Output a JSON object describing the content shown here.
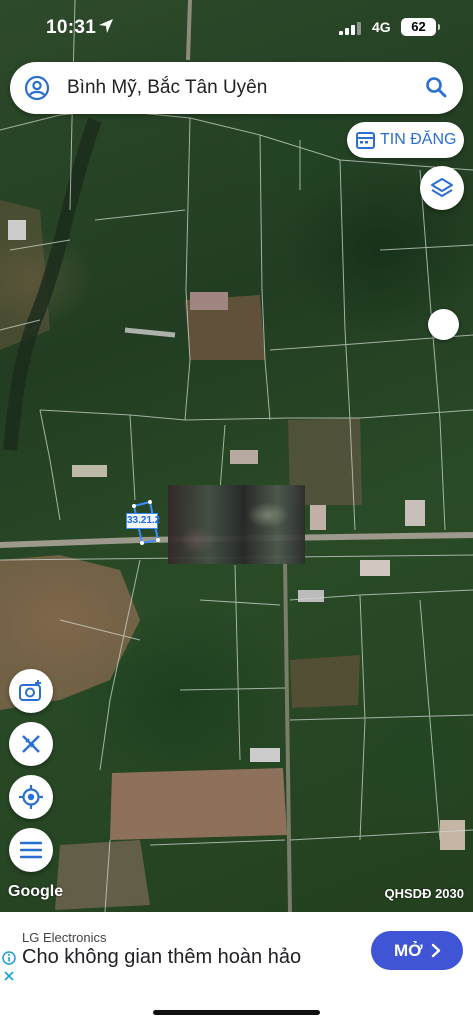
{
  "status_bar": {
    "time": "10:31",
    "network": "4G",
    "battery": "62"
  },
  "search": {
    "query": "Bình Mỹ, Bắc Tân Uyên"
  },
  "listing_button": {
    "label": "TIN ĐĂNG"
  },
  "map": {
    "parcel_label": "33.21.2",
    "attribution": "Google",
    "plan_label": "QHSDĐ 2030"
  },
  "ad": {
    "advertiser": "LG Electronics",
    "headline": "Cho không gian thêm hoàn hảo",
    "cta_label": "MỞ"
  },
  "icons": {
    "account": "user-circle-icon",
    "search": "search-icon",
    "listing": "calendar-icon",
    "layers": "layers-icon",
    "camera": "camera-plus-icon",
    "measure": "ruler-pencil-icon",
    "location": "my-location-icon",
    "menu": "menu-icon"
  },
  "colors": {
    "accent_blue": "#2a6fd1",
    "cta_blue": "#3f55d6",
    "parcel_outline": "#3d8cff"
  }
}
